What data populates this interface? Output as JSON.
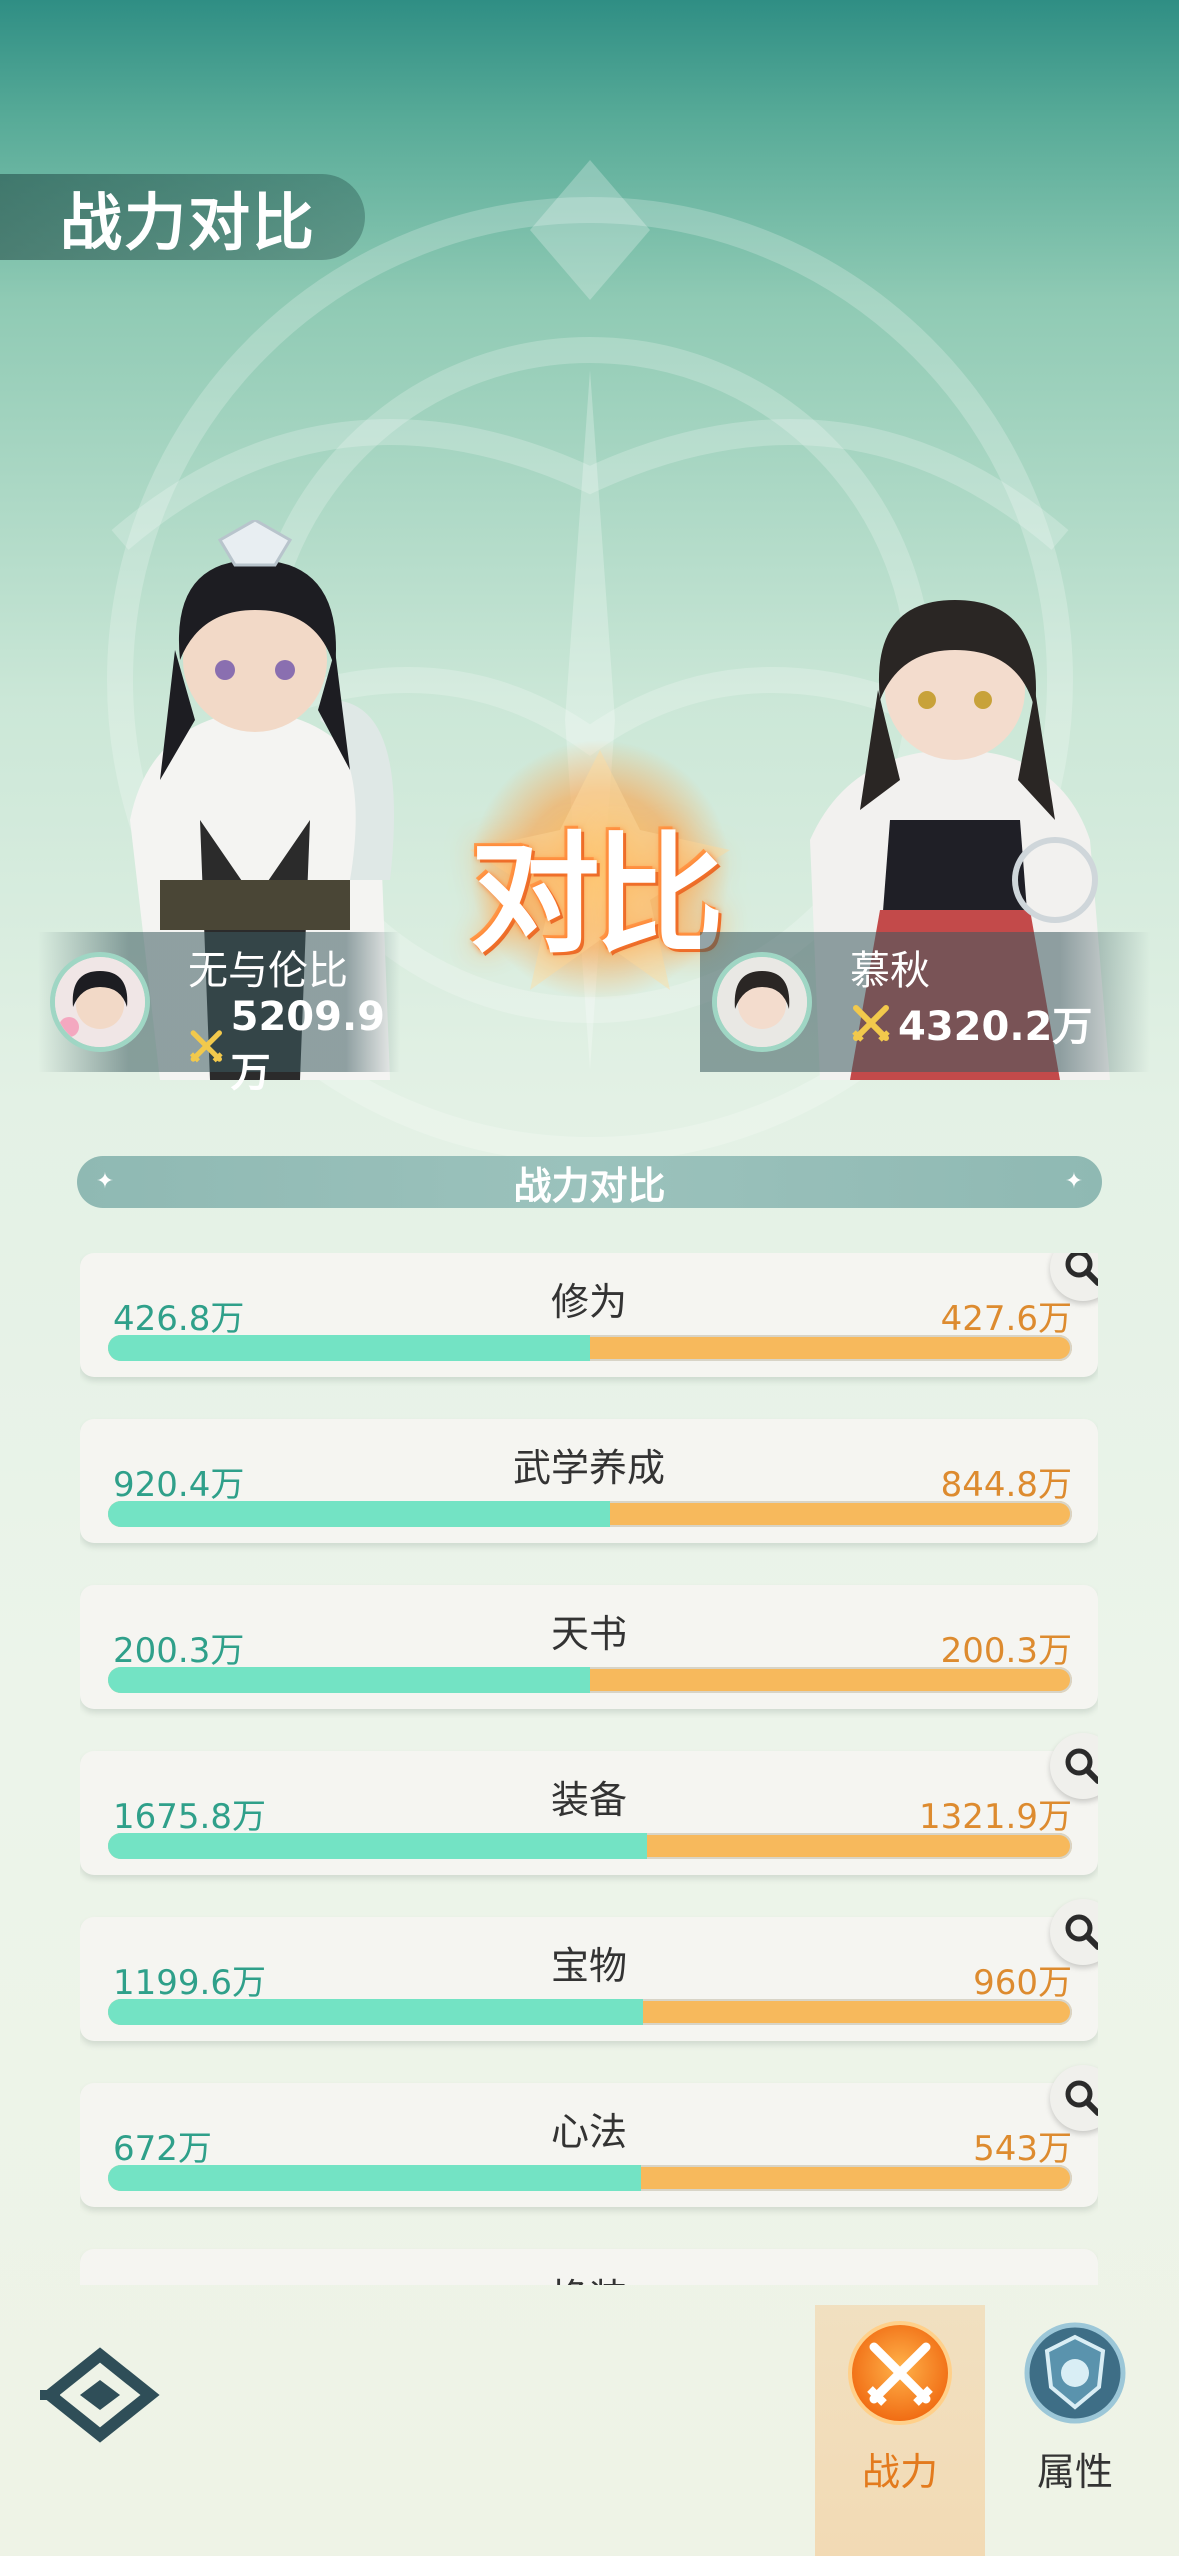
{
  "header": {
    "title": "战力对比"
  },
  "vs_text": "对比",
  "players": {
    "left": {
      "name": "无与伦比",
      "power": "5209.9万"
    },
    "right": {
      "name": "慕秋",
      "power": "4320.2万"
    }
  },
  "section": {
    "title": "战力对比"
  },
  "rows": [
    {
      "label": "修为",
      "left": "426.8万",
      "right": "427.6万",
      "left_share": 0.4995,
      "magnifier": true
    },
    {
      "label": "武学养成",
      "left": "920.4万",
      "right": "844.8万",
      "left_share": 0.521,
      "magnifier": false
    },
    {
      "label": "天书",
      "left": "200.3万",
      "right": "200.3万",
      "left_share": 0.5,
      "magnifier": false
    },
    {
      "label": "装备",
      "left": "1675.8万",
      "right": "1321.9万",
      "left_share": 0.559,
      "magnifier": true
    },
    {
      "label": "宝物",
      "left": "1199.6万",
      "right": "960万",
      "left_share": 0.555,
      "magnifier": true
    },
    {
      "label": "心法",
      "left": "672万",
      "right": "543万",
      "left_share": 0.553,
      "magnifier": true
    },
    {
      "label": "换装",
      "left": "",
      "right": "",
      "left_share": 0.5,
      "magnifier": false
    }
  ],
  "tabs": [
    {
      "label": "战力",
      "active": true,
      "icon": "crossed-swords-icon"
    },
    {
      "label": "属性",
      "active": false,
      "icon": "shield-emblem-icon"
    }
  ],
  "colors": {
    "left_bar": "#73e3c4",
    "right_bar": "#f7b95c",
    "left_value": "#2fa08a",
    "right_value": "#dd8b2f",
    "active_tab": "#e37a1d"
  }
}
